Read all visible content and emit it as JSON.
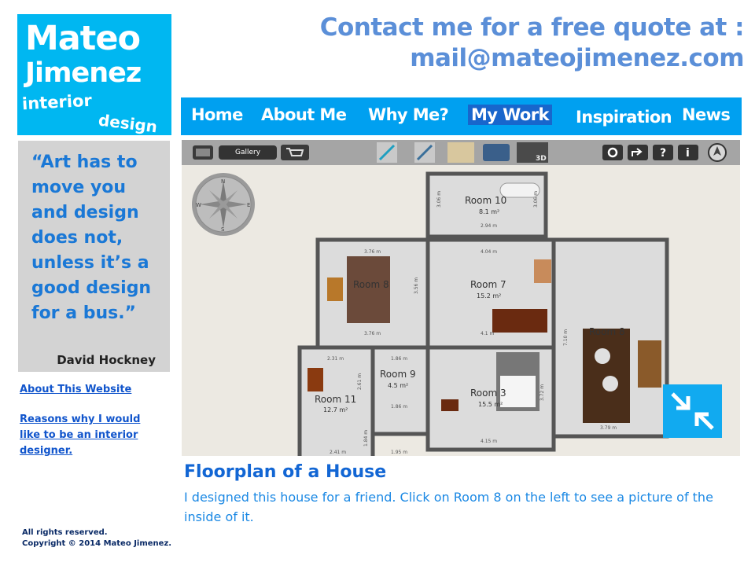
{
  "logo": {
    "line1": "Mateo",
    "line2": "Jimenez",
    "line3": "interior",
    "line4": "design",
    "color": "#00b7f1"
  },
  "contact": {
    "line1": "Contact me for a free quote at :",
    "line2": "mail@mateojimenez.com",
    "color": "#5b8fd8"
  },
  "nav": {
    "items": [
      {
        "label": "Home",
        "active": false
      },
      {
        "label": "About Me",
        "active": false
      },
      {
        "label": "Why Me?",
        "active": false
      },
      {
        "label": "My Work",
        "active": true
      },
      {
        "label": "Inspiration",
        "active": false
      },
      {
        "label": "News",
        "active": false
      }
    ],
    "color": "#00a0f0",
    "active_color": "#1866cc"
  },
  "quote": {
    "text": "“Art has to move you and design does not, unless it’s a good design for a bus.”",
    "author": "David Hockney"
  },
  "sidebar": {
    "about_link": "About This Website",
    "reasons_link": "Reasons why I would like to be an interior designer."
  },
  "footer": {
    "line1": "All rights reserved.",
    "line2": "Copyright © 2014 Mateo Jimenez."
  },
  "viewer": {
    "toolbar": {
      "gallery_label": "Gallery",
      "badge_3d": "3D",
      "help": "?",
      "info": "i",
      "icons": [
        "window-icon",
        "cart-icon",
        "measure-icon",
        "pencil-icon",
        "door-icon",
        "sofa-icon",
        "3d-view-icon",
        "settings-icon",
        "share-icon",
        "help-icon",
        "info-icon",
        "compass-arrow-icon",
        "fullscreen-exit-icon"
      ]
    },
    "compass": {
      "n": "N",
      "s": "S",
      "e": "E",
      "w": "W"
    },
    "rooms": [
      {
        "name": "Room 10",
        "area": "8.1 m²"
      },
      {
        "name": "Room 8",
        "area": ""
      },
      {
        "name": "Room 7",
        "area": "15.2 m²"
      },
      {
        "name": "Room 8",
        "area": ""
      },
      {
        "name": "Room 9",
        "area": "4.5 m²"
      },
      {
        "name": "Room 3",
        "area": "15.5 m²"
      },
      {
        "name": "Room 11",
        "area": "12.7 m²"
      }
    ],
    "dimensions": [
      "3.06 m",
      "3.06 m",
      "2.94 m",
      "3.76 m",
      "4.04 m",
      "3.56 m",
      "3.76 m",
      "4.1 m",
      "7.10 m",
      "3.79 m",
      "2.31 m",
      "2.61 m",
      "1.86 m",
      "3.72 m",
      "1.86 m",
      "4.15 m",
      "2.41 m",
      "1.95 m",
      "1.84 m"
    ]
  },
  "caption": {
    "title": "Floorplan of a House",
    "text": "I designed this house for a friend. Click on Room 8 on the left to see a picture of the inside of it."
  }
}
